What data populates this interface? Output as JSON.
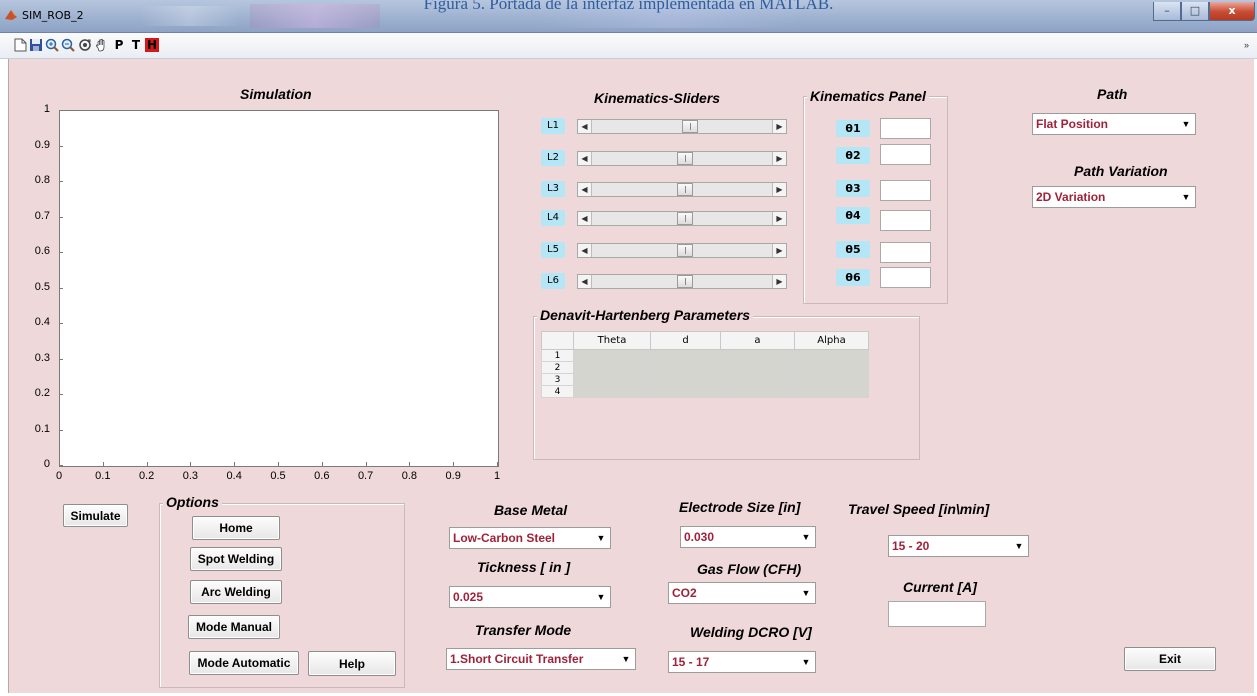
{
  "caption": "Figura 5. Portada de la interfaz implementada en MATLAB.",
  "window": {
    "title": "SIM_ROB_2",
    "controls": {
      "minimize": "–",
      "maximize": "□",
      "close": "x"
    }
  },
  "toolbar": {
    "icons": [
      "new-file-icon",
      "save-icon",
      "zoom-in-icon",
      "zoom-out-icon",
      "rotate-3d-icon",
      "pan-hand-icon",
      "p-icon",
      "t-icon",
      "h-icon"
    ],
    "p_label": "P",
    "t_label": "T",
    "h_label": "H",
    "overflow_arrow": "»"
  },
  "axes": {
    "title": "Simulation",
    "yticks": [
      "1",
      "0.9",
      "0.8",
      "0.7",
      "0.6",
      "0.5",
      "0.4",
      "0.3",
      "0.2",
      "0.1",
      "0"
    ],
    "xticks": [
      "0",
      "0.1",
      "0.2",
      "0.3",
      "0.4",
      "0.5",
      "0.6",
      "0.7",
      "0.8",
      "0.9",
      "1"
    ]
  },
  "buttons": {
    "simulate": "Simulate",
    "home": "Home",
    "spot_welding": "Spot Welding",
    "arc_welding": "Arc Welding",
    "mode_manual": "Mode Manual",
    "mode_automatic": "Mode Automatic",
    "help": "Help",
    "exit": "Exit"
  },
  "options_panel": {
    "title": "Options"
  },
  "kinematics_sliders": {
    "title": "Kinematics-Sliders",
    "sliders": [
      {
        "label": "L1",
        "value_fraction": 0.54
      },
      {
        "label": "L2",
        "value_fraction": 0.51
      },
      {
        "label": "L3",
        "value_fraction": 0.51
      },
      {
        "label": "L4",
        "value_fraction": 0.51
      },
      {
        "label": "L5",
        "value_fraction": 0.51
      },
      {
        "label": "L6",
        "value_fraction": 0.51
      }
    ]
  },
  "kinematics_panel": {
    "title": "Kinematics Panel",
    "thetas": [
      {
        "label": "θ1",
        "value": ""
      },
      {
        "label": "θ2",
        "value": ""
      },
      {
        "label": "θ3",
        "value": ""
      },
      {
        "label": "θ4",
        "value": ""
      },
      {
        "label": "θ5",
        "value": ""
      },
      {
        "label": "θ6",
        "value": ""
      }
    ]
  },
  "dh_parameters": {
    "title": "Denavit-Hartenberg Parameters",
    "columns": [
      "Theta",
      "d",
      "a",
      "Alpha"
    ],
    "rows": [
      "1",
      "2",
      "3",
      "4"
    ]
  },
  "path": {
    "title": "Path",
    "selected": "Flat Position",
    "variation_title": "Path Variation",
    "variation_selected": "2D Variation"
  },
  "welding": {
    "base_metal": {
      "label": "Base Metal",
      "selected": "Low-Carbon Steel"
    },
    "thickness": {
      "label": "Tickness  [ in ]",
      "selected": "0.025"
    },
    "transfer_mode": {
      "label": "Transfer Mode",
      "selected": "1.Short Circuit Transfer"
    },
    "electrode_size": {
      "label": "Electrode Size [in]",
      "selected": "0.030"
    },
    "gas_flow": {
      "label": "Gas Flow (CFH)",
      "selected": "CO2"
    },
    "welding_dcro": {
      "label": "Welding DCRO [V]",
      "selected": "15 - 17"
    },
    "travel_speed": {
      "label": "Travel Speed [in\\min]",
      "selected": "15 - 20"
    },
    "current": {
      "label": "Current [A]",
      "value": ""
    }
  },
  "colors": {
    "figure_bg": "#efd8da",
    "accent_label_bg": "#b5e6f5",
    "dropdown_text": "#a0223a"
  }
}
